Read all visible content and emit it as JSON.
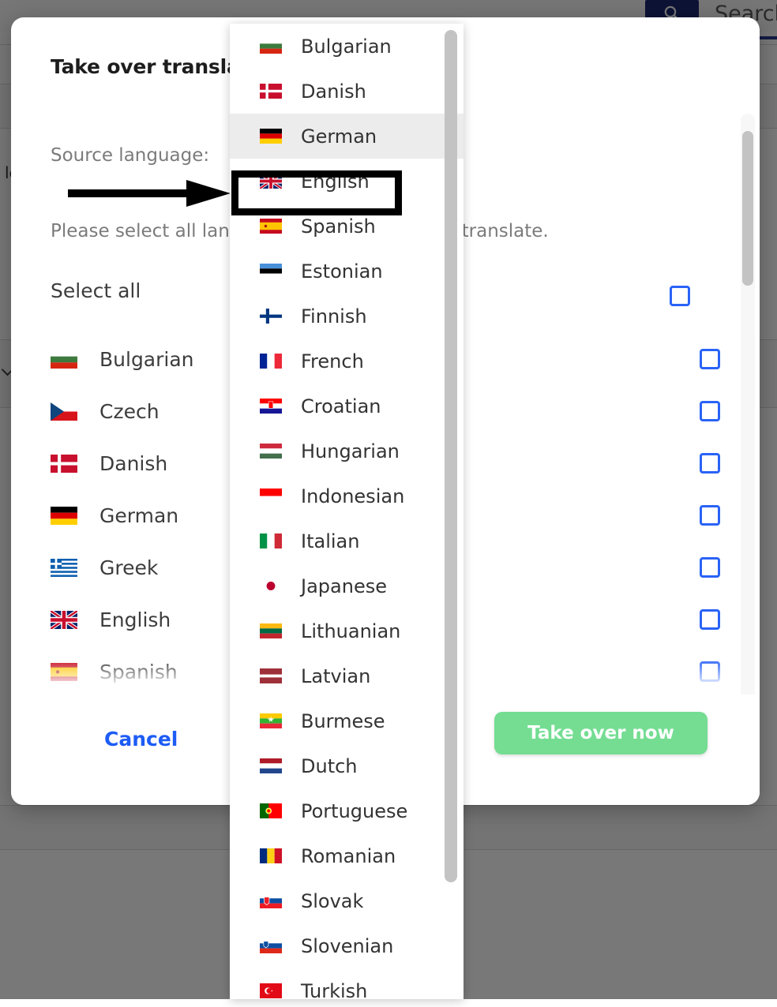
{
  "background": {
    "search_button_icon": "search-icon",
    "search_label": "Search",
    "rows": [
      {
        "text": "le",
        "has_chevron": false
      },
      {
        "text": "",
        "has_chevron": true
      },
      {
        "text": "",
        "has_chevron": false
      },
      {
        "text": "",
        "has_chevron": false
      },
      {
        "text": "",
        "has_chevron": false
      },
      {
        "text": "",
        "has_chevron": false
      }
    ]
  },
  "modal": {
    "title": "Take over translations",
    "source_language_label": "Source language:",
    "hint": "Please select all languages you would like to translate.",
    "select_all_label": "Select all",
    "languages": [
      {
        "name": "Bulgarian",
        "flag": "bg",
        "checked": false
      },
      {
        "name": "Czech",
        "flag": "cz",
        "checked": false
      },
      {
        "name": "Danish",
        "flag": "dk",
        "checked": false
      },
      {
        "name": "German",
        "flag": "de",
        "checked": false
      },
      {
        "name": "Greek",
        "flag": "gr",
        "checked": false
      },
      {
        "name": "English",
        "flag": "gb",
        "checked": false
      },
      {
        "name": "Spanish",
        "flag": "es",
        "checked": false
      }
    ],
    "cancel_label": "Cancel",
    "take_over_label": "Take over now",
    "accent_color": "#1d5cf5",
    "confirm_color": "#74dd92",
    "checkbox_color": "#2a63f6"
  },
  "dropdown": {
    "selected": "German",
    "focused": "English",
    "options": [
      {
        "name": "Bulgarian",
        "flag": "bg"
      },
      {
        "name": "Danish",
        "flag": "dk"
      },
      {
        "name": "German",
        "flag": "de"
      },
      {
        "name": "English",
        "flag": "gb"
      },
      {
        "name": "Spanish",
        "flag": "es"
      },
      {
        "name": "Estonian",
        "flag": "ee"
      },
      {
        "name": "Finnish",
        "flag": "fi"
      },
      {
        "name": "French",
        "flag": "fr"
      },
      {
        "name": "Croatian",
        "flag": "hr"
      },
      {
        "name": "Hungarian",
        "flag": "hu"
      },
      {
        "name": "Indonesian",
        "flag": "id"
      },
      {
        "name": "Italian",
        "flag": "it"
      },
      {
        "name": "Japanese",
        "flag": "jp"
      },
      {
        "name": "Lithuanian",
        "flag": "lt"
      },
      {
        "name": "Latvian",
        "flag": "lv"
      },
      {
        "name": "Burmese",
        "flag": "mm"
      },
      {
        "name": "Dutch",
        "flag": "nl"
      },
      {
        "name": "Portuguese",
        "flag": "pt"
      },
      {
        "name": "Romanian",
        "flag": "ro"
      },
      {
        "name": "Slovak",
        "flag": "sk"
      },
      {
        "name": "Slovenian",
        "flag": "si"
      },
      {
        "name": "Turkish",
        "flag": "tr"
      }
    ]
  },
  "annotation": {
    "arrow": "right-arrow-annotation",
    "highlight_target": "English",
    "color": "#000000"
  }
}
